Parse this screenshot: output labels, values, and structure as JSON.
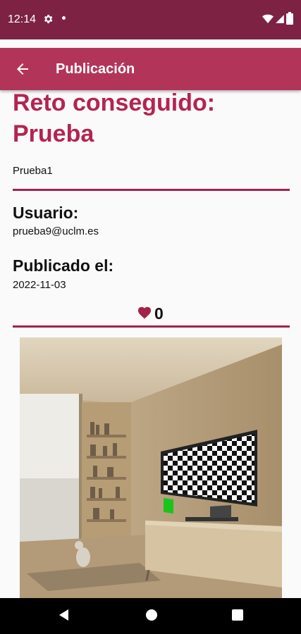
{
  "status_bar": {
    "time": "12:14"
  },
  "app_bar": {
    "title": "Publicación"
  },
  "post": {
    "heading": "Reto conseguido: Prueba",
    "description": "Prueba1",
    "user_label": "Usuario:",
    "user_value": "prueba9@uclm.es",
    "date_label": "Publicado el:",
    "date_value": "2022-11-03",
    "likes": "0"
  },
  "colors": {
    "status_bar": "#7d2243",
    "app_bar": "#b23559",
    "accent": "#b4244f",
    "divider": "#a32249"
  },
  "icons": {
    "back": "arrow-back-icon",
    "like": "heart-icon",
    "settings": "gear-icon"
  }
}
